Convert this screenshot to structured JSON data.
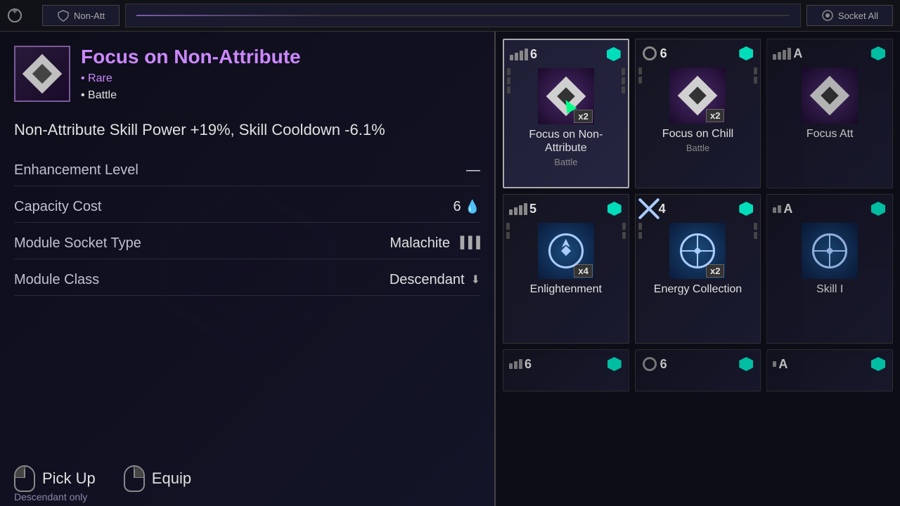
{
  "topBar": {
    "btn1": "Non-Att",
    "btn2": "Socket All"
  },
  "leftPanel": {
    "itemName": "Focus on Non-Attribute",
    "rarity": "• Rare",
    "type": "• Battle",
    "description": "Non-Attribute Skill Power +19%, Skill Cooldown -6.1%",
    "stats": [
      {
        "label": "Enhancement Level",
        "value": "—",
        "icon": ""
      },
      {
        "label": "Capacity Cost",
        "value": "6",
        "icon": "water"
      },
      {
        "label": "Module Socket Type",
        "value": "Malachite",
        "icon": "malachite"
      },
      {
        "label": "Module Class",
        "value": "Descendant",
        "icon": "descendant"
      }
    ],
    "actions": [
      {
        "label": "Pick Up"
      },
      {
        "label": "Equip"
      }
    ],
    "bottomNote": "Descendant only"
  },
  "rightPanel": {
    "cards": [
      {
        "id": "focus-non-attr",
        "level": "6",
        "levelType": "bars4",
        "socketColor": "teal",
        "iconType": "diamond",
        "bgColor": "purple",
        "multiplier": "x2",
        "name": "Focus on Non-Attribute",
        "subtype": "Battle",
        "selected": true,
        "hasCursor": true
      },
      {
        "id": "focus-chill",
        "level": "6",
        "levelType": "circle",
        "socketColor": "teal",
        "iconType": "diamond",
        "bgColor": "purple",
        "multiplier": "x2",
        "name": "Focus on Chill",
        "subtype": "Battle",
        "selected": false
      },
      {
        "id": "focus-att",
        "level": "A",
        "levelType": "bars4",
        "socketColor": "teal",
        "iconType": "diamond",
        "bgColor": "purple",
        "multiplier": "",
        "name": "Focus Att",
        "subtype": "",
        "selected": false,
        "partial": true
      },
      {
        "id": "enlightenment",
        "level": "5",
        "levelType": "bars4",
        "socketColor": "teal",
        "iconType": "compass",
        "bgColor": "blue",
        "multiplier": "x4",
        "name": "Enlightenment",
        "subtype": "",
        "selected": false
      },
      {
        "id": "energy-collection",
        "level": "4",
        "levelType": "x",
        "socketColor": "teal",
        "iconType": "crosshair",
        "bgColor": "blue",
        "multiplier": "x2",
        "name": "Energy Collection",
        "subtype": "",
        "selected": false
      },
      {
        "id": "skill-insight",
        "level": "A",
        "levelType": "bars4",
        "socketColor": "teal",
        "iconType": "crosshair",
        "bgColor": "blue",
        "multiplier": "",
        "name": "Skill I",
        "subtype": "",
        "selected": false,
        "partial": true
      },
      {
        "id": "card-7",
        "level": "6",
        "levelType": "bars4",
        "socketColor": "teal",
        "iconType": "diamond",
        "bgColor": "purple",
        "multiplier": "",
        "name": "",
        "subtype": "",
        "selected": false,
        "partial": true,
        "bottom": true
      },
      {
        "id": "card-8",
        "level": "6",
        "levelType": "circle",
        "socketColor": "teal",
        "iconType": "diamond",
        "bgColor": "purple",
        "multiplier": "",
        "name": "",
        "subtype": "",
        "selected": false,
        "partial": true,
        "bottom": true
      },
      {
        "id": "card-9",
        "level": "A",
        "levelType": "bars4",
        "socketColor": "teal",
        "iconType": "diamond",
        "bgColor": "purple",
        "multiplier": "",
        "name": "",
        "subtype": "",
        "selected": false,
        "partial": true,
        "bottom": true
      }
    ]
  }
}
